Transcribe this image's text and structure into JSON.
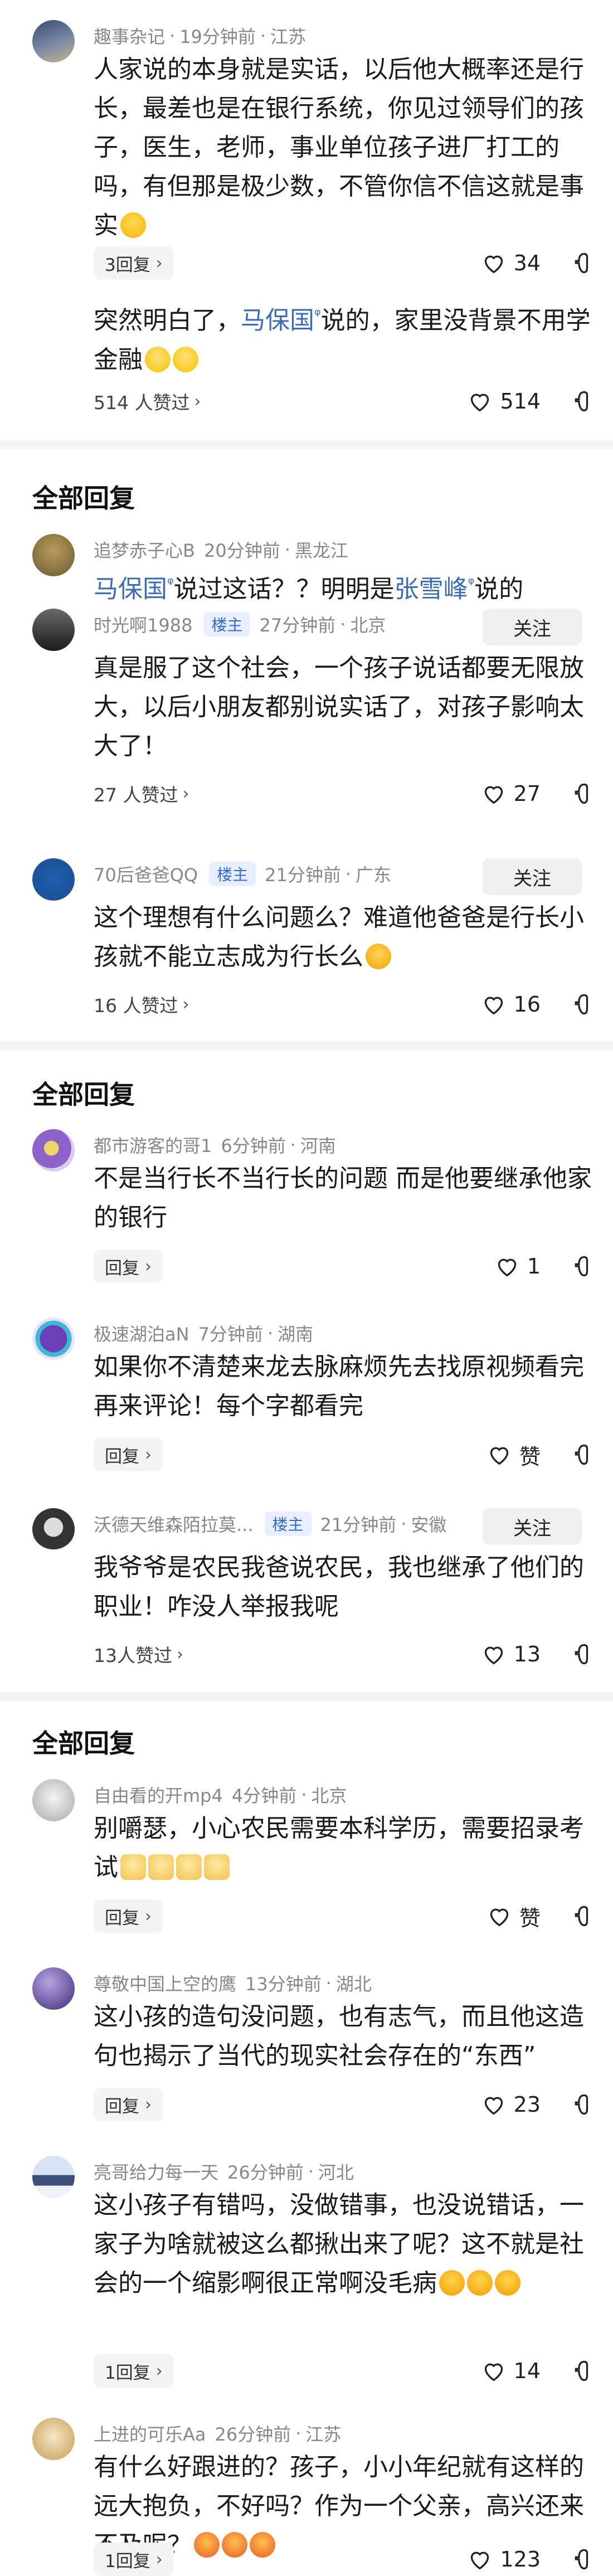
{
  "comments": [
    {
      "name": "趣事杂记",
      "time": "19分钟前",
      "location": "江苏",
      "text": "人家说的本身就是实话，以后他大概率还是行长，最差也是在银行系统，你见过领导们的孩子，医生，老师，事业单位孩子进厂打工的吗，有但那是极少数，不管你信不信这就是事实",
      "reply_label": "3回复",
      "likes": "34",
      "emoji": "laugh"
    },
    {
      "text_a": "突然明白了，",
      "link": "马保国",
      "text_b": "说的，家里没背景不用学金融",
      "reply_label": "514 人赞过",
      "likes": "514",
      "emoji": "smile"
    },
    {
      "name": "追梦赤子心B",
      "time": "20分钟前",
      "location": "黑龙江",
      "link1": "马保国",
      "text_a": "说过这话？？明明是",
      "link2": "张雪峰",
      "text_b": "说的"
    },
    {
      "name": "时光啊1988",
      "owner": "楼主",
      "time": "27分钟前",
      "location": "北京",
      "follow": "关注",
      "text": "真是服了这个社会，一个孩子说话都要无限放大，以后小朋友都别说实话了，对孩子影响太大了！",
      "reply_label": "27 人赞过",
      "likes": "27"
    },
    {
      "name": "70后爸爸QQ",
      "owner": "楼主",
      "time": "21分钟前",
      "location": "广东",
      "follow": "关注",
      "text": "这个理想有什么问题么？难道他爸爸是行长小孩就不能立志成为行长么",
      "reply_label": "16 人赞过",
      "likes": "16",
      "emoji": "cry"
    },
    {
      "name": "都市游客的哥1",
      "time": "6分钟前",
      "location": "河南",
      "text": "不是当行长不当行长的问题 而是他要继承他家的银行",
      "reply_label": "回复",
      "likes": "1"
    },
    {
      "name": "极速湖泊aN",
      "time": "7分钟前",
      "location": "湖南",
      "text": "如果你不清楚来龙去脉麻烦先去找原视频看完再来评论！每个字都看完",
      "reply_label": "回复",
      "likes": "赞"
    },
    {
      "name": "沃德天维森陌拉莫...",
      "owner": "楼主",
      "time": "21分钟前",
      "location": "安徽",
      "follow": "关注",
      "text": "我爷爷是农民我爸说农民，我也继承了他们的职业！咋没人举报我呢",
      "reply_label": "13人赞过",
      "likes": "13"
    },
    {
      "name": "自由看的开mp4",
      "time": "4分钟前",
      "location": "北京",
      "text": "别嚼瑟，小心农民需要本科学历，需要招录考试",
      "reply_label": "回复",
      "likes": "赞",
      "emoji": "dog"
    },
    {
      "name": "尊敬中国上空的鹰",
      "time": "13分钟前",
      "location": "湖北",
      "text": "这小孩的造句没问题，也有志气，而且他这造句也揭示了当代的现实社会存在的“东西”",
      "reply_label": "回复",
      "likes": "23"
    },
    {
      "name": "亮哥给力每一天",
      "time": "26分钟前",
      "location": "河北",
      "text": "这小孩子有错吗，没做错事，也没说错话，一家子为啥就被这么都揪出来了呢？这不就是社会的一个缩影啊很正常啊没毛病",
      "reply_label": "1回复",
      "likes": "14",
      "emoji": "shock"
    },
    {
      "name": "上进的可乐Aa",
      "time": "26分钟前",
      "location": "江苏",
      "text": "有什么好跟进的？孩子，小小年纪就有这样的远大抱负，不好吗？作为一个父亲，高兴还来不及呢？",
      "reply_label": "1回复",
      "likes": "123",
      "emoji": "tongue"
    }
  ],
  "sections": {
    "all_replies": "全部回复"
  },
  "icons": {
    "like": "heart-icon",
    "dislike": "thumbs-down-icon",
    "search": "search-sup-icon",
    "chevron": "chevron-right-icon"
  },
  "colors": {
    "link": "#3b6db5",
    "owner_badge": "#3867d6",
    "meta": "#888888"
  }
}
